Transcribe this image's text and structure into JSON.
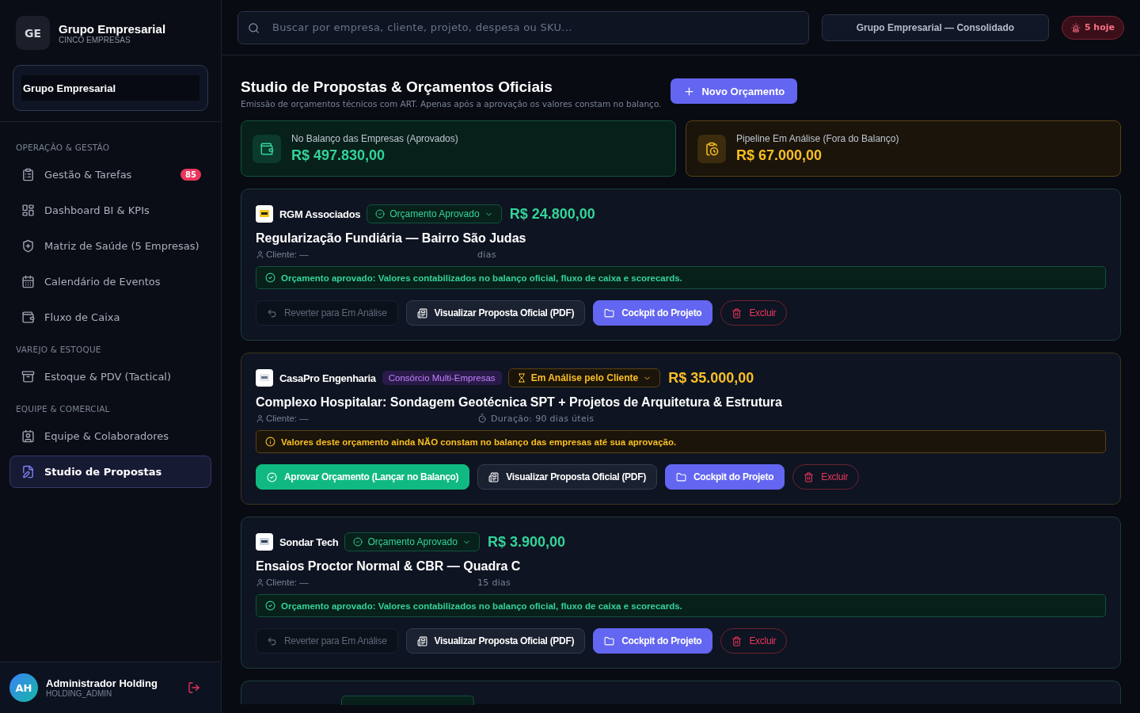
{
  "sidebar": {
    "logo_initials": "GE",
    "title": "Grupo Empresarial",
    "subtitle": "CINCO EMPRESAS",
    "company_select": "Grupo Empresarial",
    "sections": [
      {
        "label": "OPERAÇÃO & GESTÃO",
        "items": [
          {
            "label": "Gestão & Tarefas",
            "badge": "85",
            "selected": false
          },
          {
            "label": "Dashboard BI & KPIs",
            "selected": false
          },
          {
            "label": "Matriz de Saúde (5 Empresas)",
            "selected": false
          },
          {
            "label": "Calendário de Eventos",
            "selected": false
          },
          {
            "label": "Fluxo de Caixa",
            "selected": false
          }
        ]
      },
      {
        "label": "VAREJO & ESTOQUE",
        "items": [
          {
            "label": "Estoque & PDV (Tactical)",
            "selected": false
          }
        ]
      },
      {
        "label": "EQUIPE & COMERCIAL",
        "items": [
          {
            "label": "Equipe & Colaboradores",
            "selected": false
          },
          {
            "label": "Studio de Propostas",
            "selected": true
          }
        ]
      }
    ],
    "user": {
      "initials": "AH",
      "name": "Administrador Holding",
      "role": "HOLDING_ADMIN"
    }
  },
  "topbar": {
    "search": {
      "placeholder": "Buscar por empresa, cliente, projeto, despesa ou SKU..."
    },
    "scope": "Grupo Empresarial — Consolidado",
    "alerts": "5 hoje"
  },
  "page": {
    "title": "Studio de Propostas & Orçamentos Oficiais",
    "subtitle": "Emissão de orçamentos técnicos com ART. Apenas após a aprovação os valores constam no balanço.",
    "new_button": "Novo Orçamento"
  },
  "summary": [
    {
      "kind": "approved",
      "label": "No Balanço das Empresas (Aprovados)",
      "value": "R$ 497.830,00"
    },
    {
      "kind": "pending",
      "label": "Pipeline Em Análise (Fora do Balanço)",
      "value": "R$ 67.000,00"
    }
  ],
  "proposals": [
    {
      "kind": "approved",
      "company": "RGM Associados",
      "status": "Orçamento Aprovado",
      "amount": "R$ 24.800,00",
      "title": "Regularização Fundiária — Bairro São Judas",
      "client": "Cliente: —",
      "duration": "dias",
      "notice": "Orçamento aprovado: Valores contabilizados no balanço oficial, fluxo de caixa e scorecards.",
      "actions": [
        "Reverter para Em Análise",
        "Visualizar Proposta Oficial (PDF)",
        "Cockpit do Projeto",
        "Excluir"
      ]
    },
    {
      "kind": "pending",
      "company": "CasaPro Engenharia",
      "tag": "Consórcio Multi-Empresas",
      "status": "Em Análise pelo Cliente",
      "amount": "R$ 35.000,00",
      "title": "Complexo Hospitalar: Sondagem Geotécnica SPT + Projetos de Arquitetura & Estrutura",
      "client": "Cliente: —",
      "duration": "Duração: 90 dias úteis",
      "notice": "Valores deste orçamento ainda NÃO constam no balanço das empresas até sua aprovação.",
      "actions": [
        "Aprovar Orçamento (Lançar no Balanço)",
        "Visualizar Proposta Oficial (PDF)",
        "Cockpit do Projeto",
        "Excluir"
      ]
    },
    {
      "kind": "approved",
      "company": "Sondar Tech",
      "status": "Orçamento Aprovado",
      "amount": "R$ 3.900,00",
      "title": "Ensaios Proctor Normal & CBR — Quadra C",
      "client": "Cliente: —",
      "duration": "15 dias",
      "notice": "Orçamento aprovado: Valores contabilizados no balanço oficial, fluxo de caixa e scorecards.",
      "actions": [
        "Reverter para Em Análise",
        "Visualizar Proposta Oficial (PDF)",
        "Cockpit do Projeto",
        "Excluir"
      ]
    }
  ],
  "cut_card": {
    "kind": "approved"
  }
}
